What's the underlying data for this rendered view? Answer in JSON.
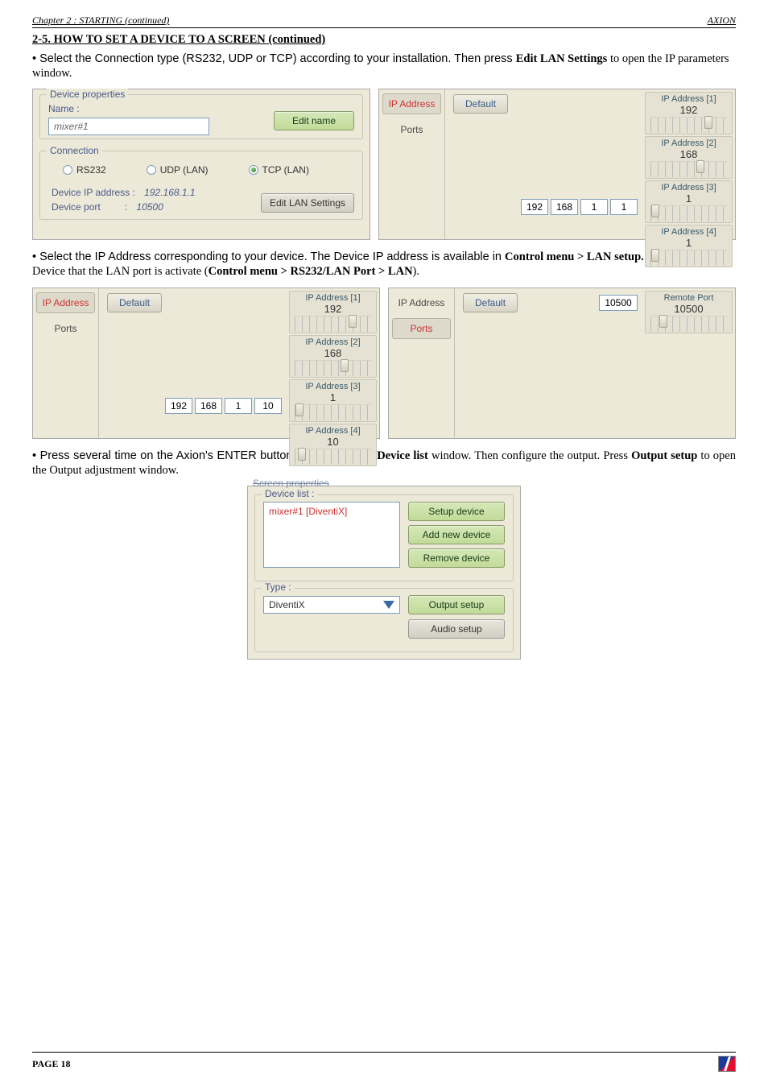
{
  "header": {
    "left": "Chapter 2 : STARTING (continued)",
    "right": "AXION"
  },
  "section_title": "2-5. HOW TO SET A DEVICE TO A SCREEN (continued)",
  "p1_a": "• Select the Connection type (RS232, UDP or TCP) according to your installation. Then press ",
  "p1_b": "Edit LAN Settings",
  "p1_c": " to open the IP parameters window.",
  "devprops": {
    "legend": "Device properties",
    "name_label": "Name :",
    "name_value": "mixer#1",
    "edit_name": "Edit name",
    "conn_legend": "Connection",
    "rs232": "RS232",
    "udp": "UDP (LAN)",
    "tcp": "TCP (LAN)",
    "dev_ip_label": "Device IP address :",
    "dev_ip_value": "192.168.1.1",
    "dev_port_label": "Device port",
    "dev_port_value": "10500",
    "edit_lan": "Edit LAN Settings"
  },
  "ip1": {
    "tab_ip": "IP Address",
    "tab_ports": "Ports",
    "default": "Default",
    "addr1_lbl": "IP Address [1]",
    "addr1_val": "192",
    "addr2_lbl": "IP Address [2]",
    "addr2_val": "168",
    "addr3_lbl": "IP Address [3]",
    "addr3_val": "1",
    "addr4_lbl": "IP Address [4]",
    "addr4_val": "1",
    "oct": [
      "192",
      "168",
      "1",
      "1"
    ]
  },
  "p2_a": "• Select the IP Address corresponding to your device. The Device IP address is available in ",
  "p2_b": "Control menu > LAN setup.",
  "p2_c": " Verify in the Device that the LAN port is activate (",
  "p2_d": "Control menu > RS232/LAN Port > LAN",
  "p2_e": ").",
  "ip2": {
    "addr4_val": "10",
    "oct": [
      "192",
      "168",
      "1",
      "10"
    ]
  },
  "ports": {
    "remote_lbl": "Remote Port",
    "remote_val": "10500",
    "port_input": "10500"
  },
  "p3_a": "• Press several time on the Axion's ENTER button to return to the ",
  "p3_b": "Device list",
  "p3_c": " window. Then configure the output. Press ",
  "p3_d": "Output setup",
  "p3_e": " to open the Output adjustment window.",
  "dlist": {
    "scratch": "Screen properties",
    "legend": "Device list :",
    "item": "mixer#1 [DiventiX]",
    "setup": "Setup device",
    "add": "Add new device",
    "remove": "Remove device",
    "type_legend": "Type :",
    "type_value": "DiventiX",
    "output_setup": "Output setup",
    "audio_setup": "Audio setup"
  },
  "footer": "PAGE 18"
}
